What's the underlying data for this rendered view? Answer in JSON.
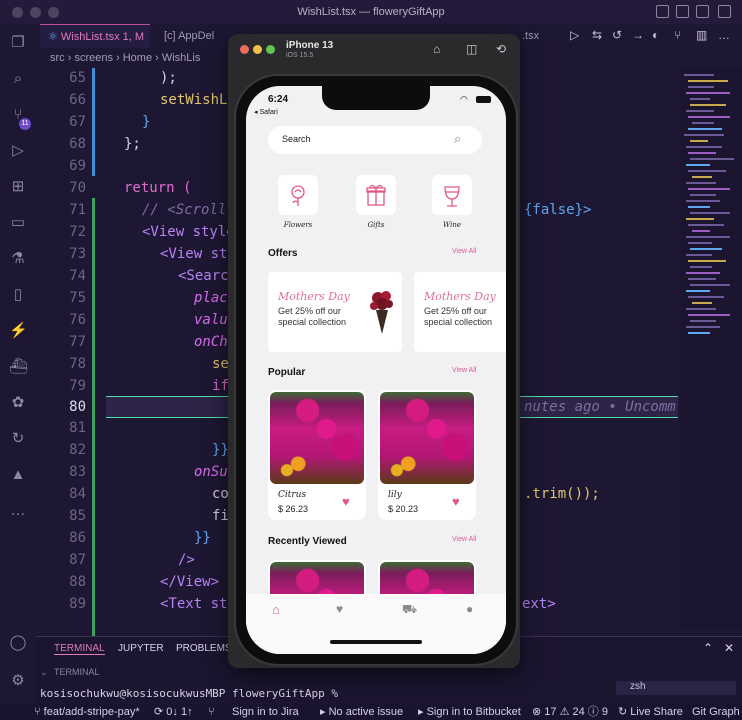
{
  "window": {
    "title": "WishList.tsx — floweryGiftApp"
  },
  "editor_tabs": [
    {
      "label": "WishList.tsx 1, M"
    },
    {
      "label": "AppDel"
    },
    {
      "label": ".tsx"
    }
  ],
  "breadcrumb": {
    "path": "src › screens › Home › WishLis"
  },
  "activity_badges": {
    "scm": "11"
  },
  "code_lines": [
    {
      "n": "65"
    },
    {
      "n": "66"
    },
    {
      "n": "67"
    },
    {
      "n": "68"
    },
    {
      "n": "69"
    },
    {
      "n": "70"
    },
    {
      "n": "71"
    },
    {
      "n": "72"
    },
    {
      "n": "73"
    },
    {
      "n": "74"
    },
    {
      "n": "75"
    },
    {
      "n": "76"
    },
    {
      "n": "77"
    },
    {
      "n": "78"
    },
    {
      "n": "79"
    },
    {
      "n": "80"
    },
    {
      "n": "81"
    },
    {
      "n": "82"
    },
    {
      "n": "83"
    },
    {
      "n": "84"
    },
    {
      "n": "85"
    },
    {
      "n": "86"
    },
    {
      "n": "87"
    },
    {
      "n": "88"
    },
    {
      "n": "89"
    }
  ],
  "code": {
    "l65": ");",
    "l66": "setWishLi",
    "l67": "}",
    "l68": "};",
    "l70": "return (",
    "l71a": "// <ScrollV",
    "l71b": "{false}>",
    "l72": "<View style",
    "l73": "<View st",
    "l74": "<Search",
    "l75": "place",
    "l76": "value",
    "l77": "onCha",
    "l78": "set",
    "l79": "if",
    "l80": "nutes ago • Uncomm",
    "l81": "}",
    "l82": "}}",
    "l83": "onSul",
    "l84a": "con",
    "l84b": ".trim());",
    "l85": "fil",
    "l86": "}}",
    "l87": "/>",
    "l88": "</View>",
    "l89a": "<Text sty",
    "l89b": "ext>"
  },
  "panel": {
    "tabs": [
      "TERMINAL",
      "JUPYTER",
      "PROBLEMS"
    ],
    "section": "TERMINAL",
    "prompt": "kosisochukwu@kosisocukwusMBP floweryGiftApp % ",
    "shell": "zsh"
  },
  "statusbar": {
    "branch": "feat/add-stripe-pay*",
    "sync": "0↓ 1↑",
    "jira": "Sign in to Jira",
    "issue": "No active issue",
    "bitbucket": "Sign in to Bitbucket",
    "problems": "⊗ 17 ⚠ 24 ⓘ 9",
    "liveshare": "Live Share",
    "gitgraph": "Git Graph"
  },
  "simulator": {
    "device": "iPhone 13",
    "os": "iOS 15.5"
  },
  "app": {
    "time": "6:24",
    "back_app": "◂ Safari",
    "search_placeholder": "Search",
    "categories": [
      {
        "label": "Flowers",
        "icon": "rose-icon"
      },
      {
        "label": "Gifts",
        "icon": "gift-icon"
      },
      {
        "label": "Wine",
        "icon": "wine-glass-icon"
      }
    ],
    "offers_title": "Offers",
    "offers_view_all": "View All",
    "offers": [
      {
        "title": "Mothers Day",
        "desc": "Get 25% off our special collection"
      },
      {
        "title": "Mothers Day",
        "desc": "Get 25% off our special collection"
      }
    ],
    "popular_title": "Popular",
    "popular_view_all": "View All",
    "popular": [
      {
        "name": "Citrus",
        "price": "$ 26.23"
      },
      {
        "name": "lily",
        "price": "$ 20.23"
      }
    ],
    "recent_title": "Recently Viewed",
    "recent_view_all": "View All"
  },
  "colors": {
    "accent": "#e0598a",
    "editor_bg": "#1e1733",
    "highlight": "#4fe0a6"
  }
}
